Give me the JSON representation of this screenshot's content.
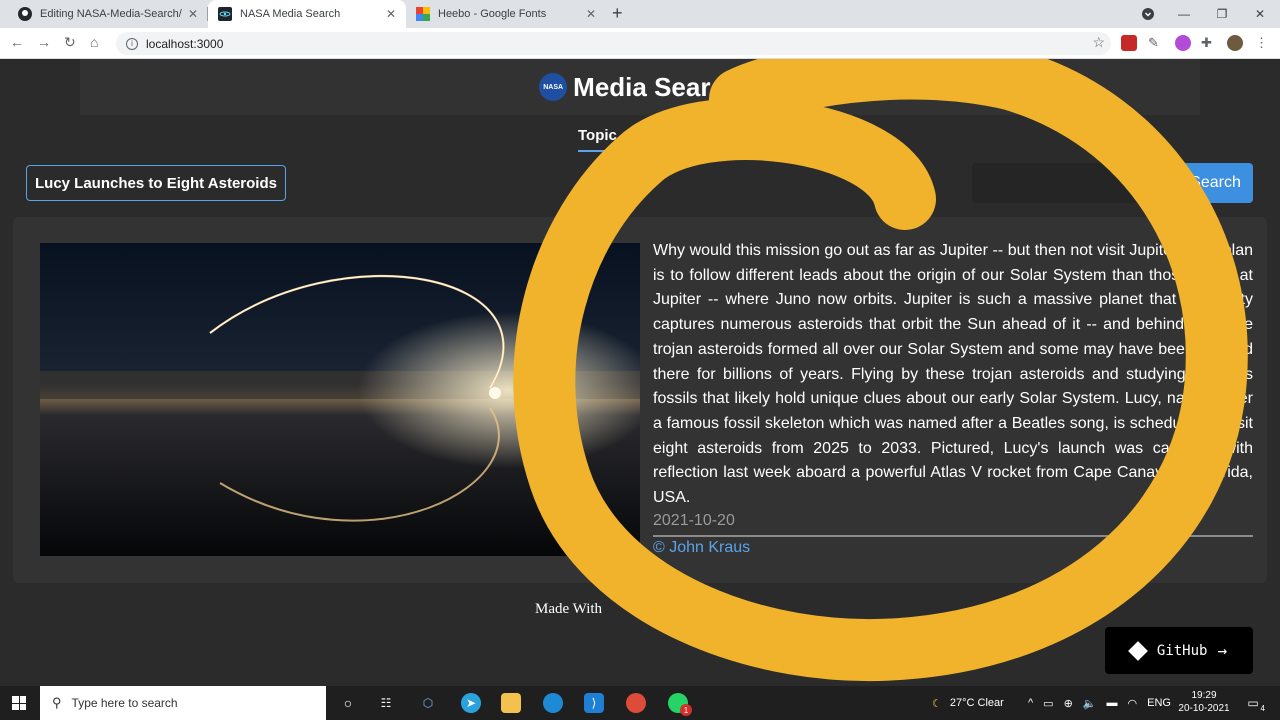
{
  "browser": {
    "tabs": [
      {
        "title": "Editing NASA-Media-Search/REA",
        "favicon": "github-icon"
      },
      {
        "title": "NASA Media Search",
        "favicon": "react-icon"
      },
      {
        "title": "Heebo - Google Fonts",
        "favicon": "google-fonts-icon"
      }
    ],
    "url": "localhost:3000"
  },
  "site": {
    "title": "Media Search",
    "logo_text": "NASA",
    "nav_tab": "Topic of",
    "current_topic": "Lucy Launches to Eight Asteroids",
    "search_button": "Search",
    "search_button_visible": "arch"
  },
  "article": {
    "description": "Why would this mission go out as far as Jupiter -- but then not visit Jupiter? The plan is to follow different leads about the origin of our Solar System than those found at Jupiter -- where Juno now orbits. Jupiter is such a massive planet that its gravity captures numerous asteroids that orbit the Sun ahead of it -- and behind it. These trojan asteroids formed all over our Solar System and some may have been trapped there for billions of years. Flying by these trojan asteroids and studying them as fossils that likely hold unique clues about our early Solar System. Lucy, named after a famous fossil skeleton which was named after a Beatles song, is scheduled to visit eight asteroids from 2025 to 2033. Pictured, Lucy's launch was captured with reflection last week aboard a powerful Atlas V rocket from Cape Canaveral, Florida, USA.",
    "date": "2021-10-20",
    "credit": "© John Kraus"
  },
  "footer": {
    "made_with": "Made With"
  },
  "github_button": "GitHub",
  "taskbar": {
    "search_placeholder": "Type here to search",
    "weather": "27°C  Clear",
    "language": "ENG",
    "time": "19:29",
    "date": "20-10-2021",
    "whatsapp_badge": "1",
    "notification_count": "4"
  },
  "colors": {
    "accent": "#3d8fe0",
    "link": "#5aa3ea",
    "page_bg": "#2b2b2b",
    "card_bg": "#333333",
    "annotation": "#f0b32b"
  }
}
